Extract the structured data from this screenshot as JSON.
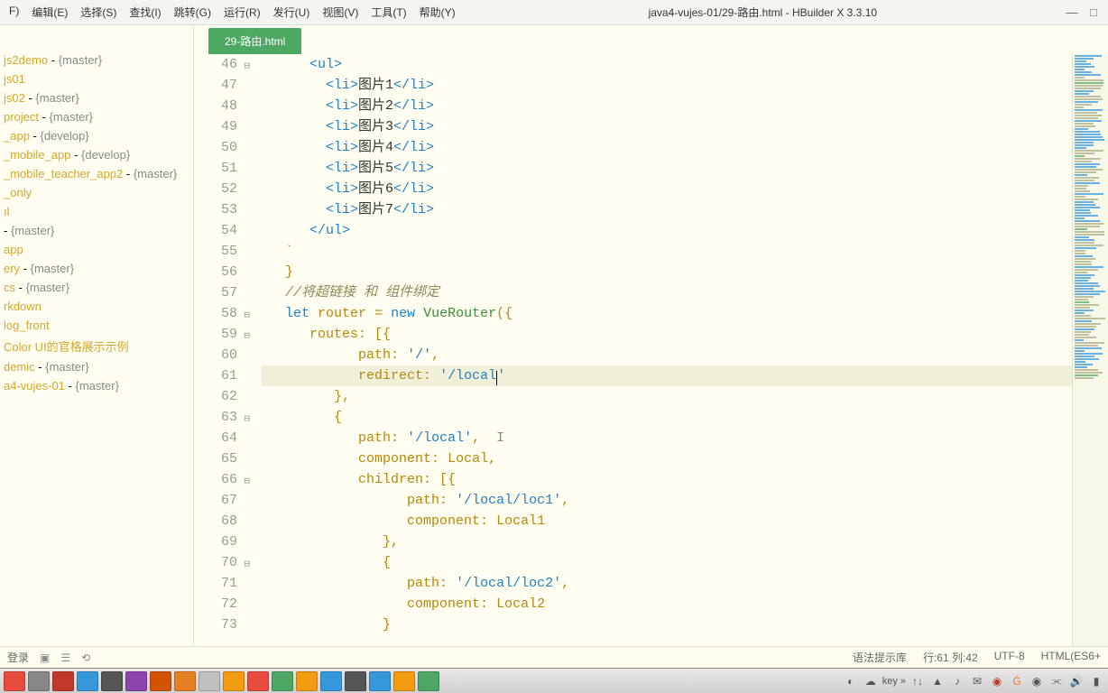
{
  "menubar": {
    "items": [
      {
        "label": "F)"
      },
      {
        "label": "编辑(E)"
      },
      {
        "label": "选择(S)"
      },
      {
        "label": "查找(I)"
      },
      {
        "label": "跳转(G)"
      },
      {
        "label": "运行(R)"
      },
      {
        "label": "发行(U)"
      },
      {
        "label": "视图(V)"
      },
      {
        "label": "工具(T)"
      },
      {
        "label": "帮助(Y)"
      }
    ],
    "title": "java4-vujes-01/29-路由.html - HBuilder X 3.3.10"
  },
  "sidebar": {
    "items": [
      {
        "name": "js2demo",
        "branch": "{master}"
      },
      {
        "name": "js01",
        "branch": ""
      },
      {
        "name": "js02",
        "branch": "{master}"
      },
      {
        "name": "project",
        "branch": "{master}"
      },
      {
        "name": "_app",
        "branch": "{develop}"
      },
      {
        "name": "_mobile_app",
        "branch": "{develop}"
      },
      {
        "name": "_mobile_teacher_app2",
        "branch": "{master}"
      },
      {
        "name": "_only",
        "branch": ""
      },
      {
        "name": "ıl",
        "branch": ""
      },
      {
        "name": "",
        "branch": "{master}"
      },
      {
        "name": "app",
        "branch": ""
      },
      {
        "name": "ery",
        "branch": "{master}"
      },
      {
        "name": "cs",
        "branch": "{master}"
      },
      {
        "name": "rkdown",
        "branch": ""
      },
      {
        "name": "log_front",
        "branch": ""
      },
      {
        "name": "Color UI的官格展示示例",
        "branch": ""
      },
      {
        "name": "demic",
        "branch": "{master}"
      },
      {
        "name": "a4-vujes-01",
        "branch": "{master}"
      }
    ]
  },
  "tab": {
    "label": "29-路由.html"
  },
  "code": {
    "startLine": 46,
    "lines": [
      {
        "n": 46,
        "fold": true,
        "html": "      <span class='k-tag'>&lt;ul&gt;</span>"
      },
      {
        "n": 47,
        "html": "        <span class='k-tag'>&lt;li&gt;</span><span class='k-text'>图片1</span><span class='k-tag'>&lt;/li&gt;</span>"
      },
      {
        "n": 48,
        "html": "        <span class='k-tag'>&lt;li&gt;</span><span class='k-text'>图片2</span><span class='k-tag'>&lt;/li&gt;</span>"
      },
      {
        "n": 49,
        "html": "        <span class='k-tag'>&lt;li&gt;</span><span class='k-text'>图片3</span><span class='k-tag'>&lt;/li&gt;</span>"
      },
      {
        "n": 50,
        "html": "        <span class='k-tag'>&lt;li&gt;</span><span class='k-text'>图片4</span><span class='k-tag'>&lt;/li&gt;</span>"
      },
      {
        "n": 51,
        "html": "        <span class='k-tag'>&lt;li&gt;</span><span class='k-text'>图片5</span><span class='k-tag'>&lt;/li&gt;</span>"
      },
      {
        "n": 52,
        "html": "        <span class='k-tag'>&lt;li&gt;</span><span class='k-text'>图片6</span><span class='k-tag'>&lt;/li&gt;</span>"
      },
      {
        "n": 53,
        "html": "        <span class='k-tag'>&lt;li&gt;</span><span class='k-text'>图片7</span><span class='k-tag'>&lt;/li&gt;</span>"
      },
      {
        "n": 54,
        "html": "      <span class='k-tag'>&lt;/ul&gt;</span>"
      },
      {
        "n": 55,
        "html": "   <span class='k-punct'>`</span>"
      },
      {
        "n": 56,
        "html": "   <span class='k-punct'>}</span>"
      },
      {
        "n": 57,
        "html": "   <span class='k-comment'>//将超链接 和 组件绑定</span>"
      },
      {
        "n": 58,
        "fold": true,
        "html": "   <span class='k-keyword'>let</span> <span class='k-var'>router</span> <span class='k-op'>=</span> <span class='k-keyword'>new</span> <span class='k-class'>VueRouter</span><span class='k-punct'>({</span>"
      },
      {
        "n": 59,
        "fold": true,
        "html": "      <span class='k-prop'>routes</span><span class='k-punct'>: [{</span>"
      },
      {
        "n": 60,
        "html": "            <span class='k-prop'>path</span><span class='k-punct'>:</span> <span class='k-string'>'/'</span><span class='k-punct'>,</span>"
      },
      {
        "n": 61,
        "cursor": true,
        "html": "            <span class='k-prop'>redirect</span><span class='k-punct'>:</span> <span class='k-string'>'/local</span><span class='text-cursor-blink'></span><span class='k-string'>'</span>"
      },
      {
        "n": 62,
        "html": "         <span class='k-punct'>},</span>"
      },
      {
        "n": 63,
        "fold": true,
        "html": "         <span class='k-punct'>{</span>"
      },
      {
        "n": 64,
        "html": "            <span class='k-prop'>path</span><span class='k-punct'>:</span> <span class='k-string'>'/local'</span><span class='k-punct'>,</span>  <span style='color:#888'>I</span>"
      },
      {
        "n": 65,
        "html": "            <span class='k-prop'>component</span><span class='k-punct'>:</span> <span class='k-local'>Local</span><span class='k-punct'>,</span>"
      },
      {
        "n": 66,
        "fold": true,
        "html": "            <span class='k-prop'>children</span><span class='k-punct'>: [{</span>"
      },
      {
        "n": 67,
        "html": "                  <span class='k-prop'>path</span><span class='k-punct'>:</span> <span class='k-string'>'/local/loc1'</span><span class='k-punct'>,</span>"
      },
      {
        "n": 68,
        "html": "                  <span class='k-prop'>component</span><span class='k-punct'>:</span> <span class='k-local'>Local1</span>"
      },
      {
        "n": 69,
        "html": "               <span class='k-punct'>},</span>"
      },
      {
        "n": 70,
        "fold": true,
        "html": "               <span class='k-punct'>{</span>"
      },
      {
        "n": 71,
        "html": "                  <span class='k-prop'>path</span><span class='k-punct'>:</span> <span class='k-string'>'/local/loc2'</span><span class='k-punct'>,</span>"
      },
      {
        "n": 72,
        "html": "                  <span class='k-prop'>component</span><span class='k-punct'>:</span> <span class='k-local'>Local2</span>"
      },
      {
        "n": 73,
        "html": "               <span class='k-punct'>}</span>"
      }
    ]
  },
  "statusbar": {
    "left": "登录",
    "syntax": "语法提示库",
    "pos": "行:61 列:42",
    "encoding": "UTF-8",
    "lang": "HTML(ES6+"
  },
  "taskbar": {
    "colors": [
      "#e74c3c",
      "#888",
      "#c0392b",
      "#3498db",
      "#555",
      "#8e44ad",
      "#d35400",
      "#e67e22",
      "#c0c0c0",
      "#f39c12",
      "#e74c3c",
      "#4ca863",
      "#f39c12",
      "#3498db",
      "#555",
      "#3498db",
      "#f39c12",
      "#4ca863"
    ],
    "key_label": "key »"
  }
}
